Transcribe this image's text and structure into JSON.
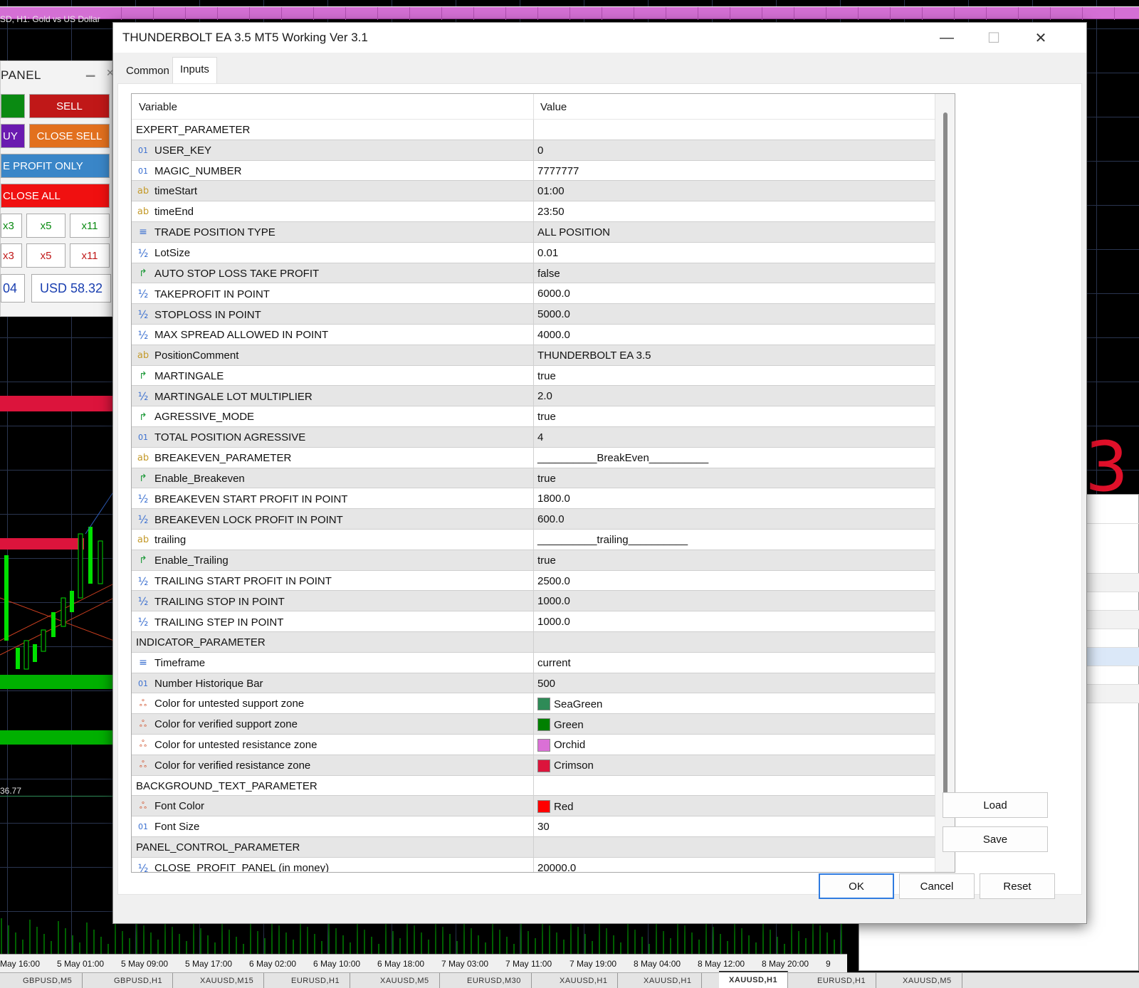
{
  "chart": {
    "title": "SD, H1:  Gold vs US Dollar",
    "price_label": "36.77",
    "big_label": "3",
    "time_labels": [
      "May 16:00",
      "5 May 01:00",
      "5 May 09:00",
      "5 May 17:00",
      "6 May 02:00",
      "6 May 10:00",
      "6 May 18:00",
      "7 May 03:00",
      "7 May 11:00",
      "7 May 19:00",
      "8 May 04:00",
      "8 May 12:00",
      "8 May 20:00",
      "9"
    ],
    "bottom_tabs": [
      "GBPUSD,M5",
      "GBPUSD,H1",
      "XAUUSD,M15",
      "EURUSD,H1",
      "XAUUSD,M5",
      "EURUSD,M30",
      "XAUUSD,H1",
      "XAUUSD,H1",
      "XAUUSD,H1",
      "EURUSD,H1",
      "XAUUSD,M5"
    ],
    "active_tab_index": 8
  },
  "panel": {
    "title": "PANEL",
    "sell_label": "SELL",
    "buy_label": "UY",
    "close_sell_label": "CLOSE SELL",
    "profit_only_label": "E PROFIT ONLY",
    "close_all_label": "CLOSE ALL",
    "mult_row1": [
      "x3",
      "x5",
      "x11"
    ],
    "mult_row2": [
      "x3",
      "x5",
      "x11"
    ],
    "money_left": "04",
    "money_right": "USD 58.32"
  },
  "dialog": {
    "title": "THUNDERBOLT EA 3.5 MT5 Working Ver 3.1",
    "tabs": [
      "Common",
      "Inputs"
    ],
    "active_tab": "Inputs",
    "columns": {
      "variable": "Variable",
      "value": "Value"
    },
    "rows": [
      {
        "type": "section",
        "name": "EXPERT_PARAMETER",
        "value": ""
      },
      {
        "type": "int",
        "name": "USER_KEY",
        "value": "0"
      },
      {
        "type": "int",
        "name": "MAGIC_NUMBER",
        "value": "7777777"
      },
      {
        "type": "string",
        "name": "timeStart",
        "value": "01:00"
      },
      {
        "type": "string",
        "name": "timeEnd",
        "value": "23:50"
      },
      {
        "type": "enum",
        "name": "TRADE POSITION TYPE",
        "value": "ALL POSITION"
      },
      {
        "type": "double",
        "name": "LotSize",
        "value": "0.01"
      },
      {
        "type": "bool",
        "name": "AUTO STOP LOSS TAKE PROFIT",
        "value": "false"
      },
      {
        "type": "double",
        "name": "TAKEPROFIT IN POINT",
        "value": "6000.0"
      },
      {
        "type": "double",
        "name": "STOPLOSS IN POINT",
        "value": "5000.0"
      },
      {
        "type": "double",
        "name": "MAX SPREAD ALLOWED IN POINT",
        "value": "4000.0"
      },
      {
        "type": "string",
        "name": "PositionComment",
        "value": "THUNDERBOLT EA 3.5"
      },
      {
        "type": "bool",
        "name": "MARTINGALE",
        "value": "true"
      },
      {
        "type": "double",
        "name": "MARTINGALE LOT MULTIPLIER",
        "value": "2.0"
      },
      {
        "type": "bool",
        "name": "AGRESSIVE_MODE",
        "value": "true"
      },
      {
        "type": "int",
        "name": "TOTAL POSITION AGRESSIVE",
        "value": "4"
      },
      {
        "type": "string",
        "name": "BREAKEVEN_PARAMETER",
        "value": "__________BreakEven__________"
      },
      {
        "type": "bool",
        "name": "Enable_Breakeven",
        "value": "true"
      },
      {
        "type": "double",
        "name": "BREAKEVEN START PROFIT IN POINT",
        "value": "1800.0"
      },
      {
        "type": "double",
        "name": "BREAKEVEN LOCK PROFIT IN POINT",
        "value": "600.0"
      },
      {
        "type": "string",
        "name": "trailing",
        "value": "__________trailing__________"
      },
      {
        "type": "bool",
        "name": "Enable_Trailing",
        "value": "true"
      },
      {
        "type": "double",
        "name": "TRAILING START PROFIT IN POINT",
        "value": "2500.0"
      },
      {
        "type": "double",
        "name": "TRAILING STOP IN POINT",
        "value": "1000.0"
      },
      {
        "type": "double",
        "name": "TRAILING STEP IN POINT",
        "value": "1000.0"
      },
      {
        "type": "section",
        "name": "INDICATOR_PARAMETER",
        "value": ""
      },
      {
        "type": "enum",
        "name": "Timeframe",
        "value": "current"
      },
      {
        "type": "int",
        "name": "Number Historique Bar",
        "value": "500"
      },
      {
        "type": "color",
        "name": "Color for untested support zone",
        "value": "SeaGreen",
        "swatch": "#2e8b57"
      },
      {
        "type": "color",
        "name": "Color for verified support zone",
        "value": "Green",
        "swatch": "#008000"
      },
      {
        "type": "color",
        "name": "Color for untested resistance zone",
        "value": "Orchid",
        "swatch": "#da70d6"
      },
      {
        "type": "color",
        "name": "Color for verified resistance zone",
        "value": "Crimson",
        "swatch": "#dc143c"
      },
      {
        "type": "section",
        "name": "BACKGROUND_TEXT_PARAMETER",
        "value": ""
      },
      {
        "type": "color",
        "name": "Font Color",
        "value": "Red",
        "swatch": "#ff0000"
      },
      {
        "type": "int",
        "name": "Font Size",
        "value": "30"
      },
      {
        "type": "section",
        "name": "PANEL_CONTROL_PARAMETER",
        "value": ""
      },
      {
        "type": "double",
        "name": "CLOSE_PROFIT_PANEL (in money)",
        "value": "20000.0"
      }
    ],
    "icons": {
      "int": "01",
      "string": "ab",
      "enum": "≡",
      "double": "½",
      "bool": "↱",
      "color": "ஃ"
    },
    "side_buttons": {
      "load": "Load",
      "save": "Save"
    },
    "footer_buttons": {
      "ok": "OK",
      "cancel": "Cancel",
      "reset": "Reset"
    }
  }
}
